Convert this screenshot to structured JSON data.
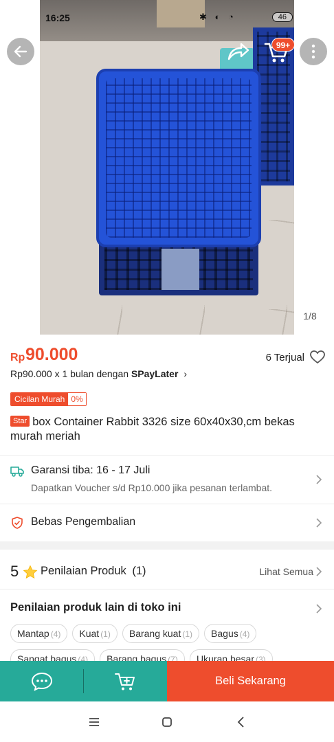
{
  "status_bar": {
    "time": "16:25",
    "signal": "46"
  },
  "gallery": {
    "counter": "1/8",
    "cart_badge": "99+"
  },
  "price": {
    "currency": "Rp",
    "amount": "90.000",
    "sold": "6 Terjual",
    "paylater_text": "Rp90.000 x 1 bulan dengan ",
    "paylater_brand": "SPayLater",
    "installment_label": "Cicilan Murah",
    "installment_rate": "0%"
  },
  "product": {
    "badge": "Star",
    "title": "box Container Rabbit 3326 size 60x40x30,cm bekas murah meriah"
  },
  "shipping": {
    "title": "Garansi tiba: 16 - 17 Juli",
    "subtitle": "Dapatkan Voucher s/d Rp10.000 jika pesanan terlambat."
  },
  "returns": {
    "title": "Bebas Pengembalian"
  },
  "rating": {
    "score": "5",
    "label": "Penilaian Produk",
    "count": "(1)",
    "see_all": "Lihat Semua"
  },
  "shop_reviews": {
    "title": "Penilaian produk lain di toko ini",
    "chips_row1": [
      {
        "label": "Mantap",
        "count": "(4)"
      },
      {
        "label": "Kuat",
        "count": "(1)"
      },
      {
        "label": "Barang kuat",
        "count": "(1)"
      },
      {
        "label": "Bagus",
        "count": "(4)"
      }
    ],
    "chips_row2": [
      {
        "label": "Sangat bagus",
        "count": "(4)"
      },
      {
        "label": "Barang bagus",
        "count": "(7)"
      },
      {
        "label": "Ukuran besar",
        "count": "(3)"
      }
    ]
  },
  "bottom_bar": {
    "buy_label": "Beli Sekarang"
  },
  "colors": {
    "brand": "#ee4d2d",
    "teal": "#26aa99"
  },
  "icons": [
    "back-arrow-icon",
    "share-icon",
    "cart-icon",
    "more-vertical-icon",
    "heart-icon",
    "truck-icon",
    "shield-icon",
    "star-icon",
    "chevron-right-icon",
    "chat-icon",
    "add-to-cart-icon",
    "nav-menu-icon",
    "nav-home-icon",
    "nav-back-icon"
  ]
}
